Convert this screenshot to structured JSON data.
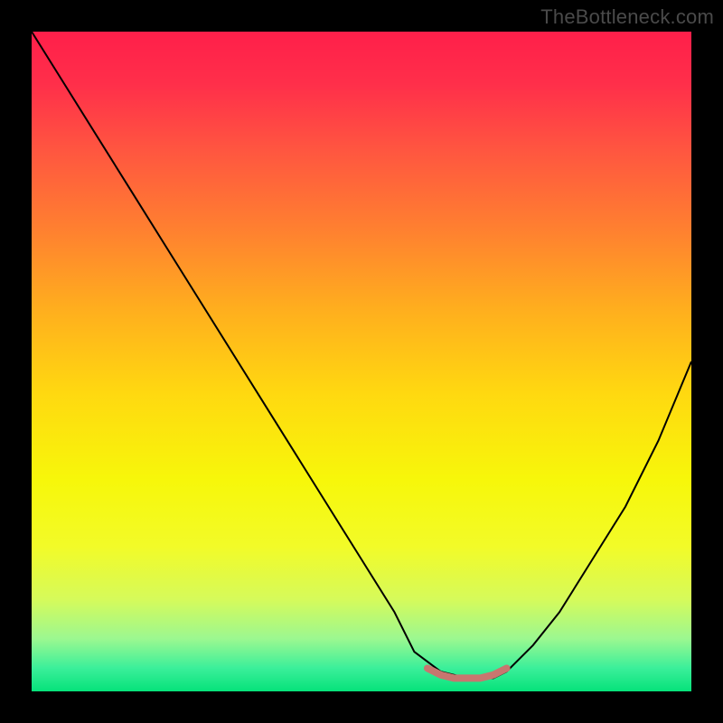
{
  "watermark": "TheBottleneck.com",
  "chart_data": {
    "type": "line",
    "title": "",
    "xlabel": "",
    "ylabel": "",
    "xlim": [
      0,
      100
    ],
    "ylim": [
      0,
      100
    ],
    "description": "V-shaped bottleneck curve over vertical red-to-green gradient background",
    "series": [
      {
        "name": "bottleneck-curve",
        "x": [
          0,
          5,
          10,
          15,
          20,
          25,
          30,
          35,
          40,
          45,
          50,
          55,
          58,
          62,
          66,
          70,
          72,
          76,
          80,
          85,
          90,
          95,
          100
        ],
        "y": [
          100,
          92,
          84,
          76,
          68,
          60,
          52,
          44,
          36,
          28,
          20,
          12,
          6,
          3,
          2,
          2,
          3,
          7,
          12,
          20,
          28,
          38,
          50
        ]
      },
      {
        "name": "trough-marker",
        "color": "#c8766f",
        "x": [
          60,
          62,
          64,
          66,
          68,
          70,
          72
        ],
        "y": [
          3.5,
          2.5,
          2.0,
          2.0,
          2.0,
          2.5,
          3.5
        ]
      }
    ],
    "background_gradient": {
      "stops": [
        {
          "offset": 0.0,
          "color": "#ff1f4a"
        },
        {
          "offset": 0.08,
          "color": "#ff2f4a"
        },
        {
          "offset": 0.18,
          "color": "#ff5640"
        },
        {
          "offset": 0.3,
          "color": "#ff8030"
        },
        {
          "offset": 0.42,
          "color": "#ffae1e"
        },
        {
          "offset": 0.55,
          "color": "#ffd910"
        },
        {
          "offset": 0.68,
          "color": "#f7f70a"
        },
        {
          "offset": 0.78,
          "color": "#f2fb28"
        },
        {
          "offset": 0.86,
          "color": "#d6fa5a"
        },
        {
          "offset": 0.92,
          "color": "#9cf890"
        },
        {
          "offset": 0.965,
          "color": "#3aef9a"
        },
        {
          "offset": 1.0,
          "color": "#06e27a"
        }
      ]
    }
  }
}
